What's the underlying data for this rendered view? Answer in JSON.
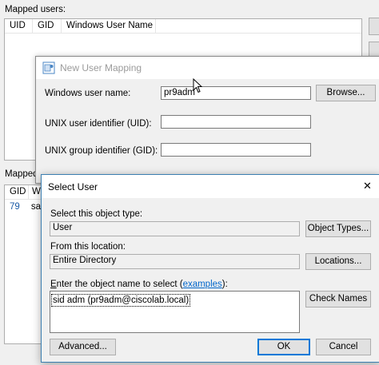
{
  "background_window": {
    "mapped_users_label": "Mapped users:",
    "mapped_users_columns": [
      "UID",
      "GID",
      "Windows User Name"
    ],
    "mapped_groups_label": "Mapped",
    "mapped_groups_columns": [
      "GID",
      "W"
    ],
    "mapped_groups_row": {
      "gid": "79",
      "name_fragment": "sa"
    }
  },
  "new_user_mapping": {
    "title": "New User Mapping",
    "windows_user_label": "Windows user name:",
    "windows_user_value": "pr9adm",
    "browse_button": "Browse...",
    "uid_label": "UNIX user identifier (UID):",
    "uid_value": "",
    "gid_label": "UNIX group identifier (GID):",
    "gid_value": ""
  },
  "select_user": {
    "title": "Select User",
    "close_glyph": "✕",
    "object_type_label": "Select this object type:",
    "object_type_value": "User",
    "object_types_button": "Object Types...",
    "location_label": "From this location:",
    "location_value": "Entire Directory",
    "locations_button": "Locations...",
    "enter_name_label_prefix": "nter the object name to select (",
    "enter_name_label_accel": "E",
    "examples_link": "examples",
    "enter_name_label_suffix": "):",
    "object_name_value": "sid adm (pr9adm@ciscolab.local)",
    "check_names_button": "Check Names",
    "advanced_button": "Advanced...",
    "ok_button": "OK",
    "cancel_button": "Cancel"
  }
}
